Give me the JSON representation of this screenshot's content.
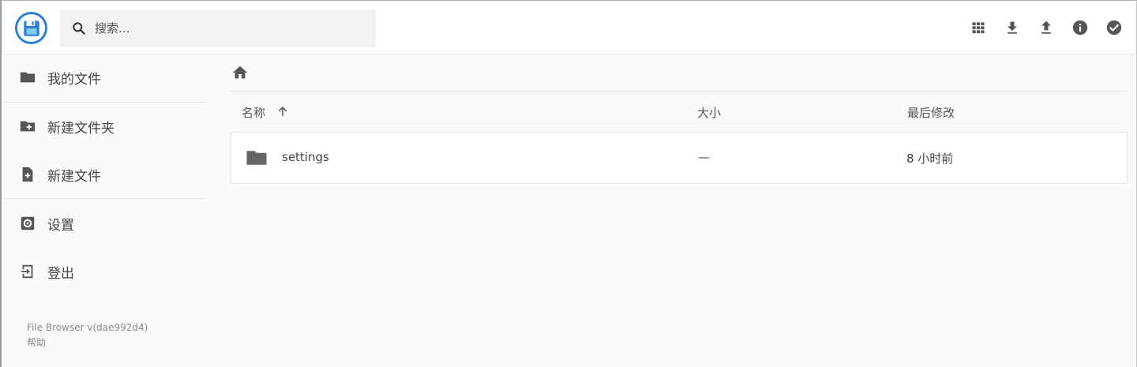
{
  "header": {
    "search": {
      "placeholder": "搜索...",
      "value": ""
    },
    "toolbar": {
      "view_mode_icon": "grid-icon",
      "download_icon": "download-icon",
      "upload_icon": "upload-icon",
      "info_icon": "info-icon",
      "select_icon": "check-circle-icon"
    }
  },
  "sidebar": {
    "items": [
      {
        "label": "我的文件",
        "icon": "folder-icon"
      },
      {
        "label": "新建文件夹",
        "icon": "folder-plus-icon"
      },
      {
        "label": "新建文件",
        "icon": "file-plus-icon"
      },
      {
        "label": "设置",
        "icon": "settings-icon"
      },
      {
        "label": "登出",
        "icon": "logout-icon"
      }
    ],
    "footer": {
      "version": "File Browser v(dae992d4)",
      "help": "帮助"
    }
  },
  "main": {
    "breadcrumb": {
      "home_icon": "home-icon"
    },
    "columns": {
      "name": "名称",
      "size": "大小",
      "modified": "最后修改"
    },
    "files": [
      {
        "name": "settings",
        "size": "—",
        "modified": "8 小时前",
        "icon": "folder-icon"
      }
    ]
  },
  "colors": {
    "accent": "#2f7ed8",
    "icon": "#555555",
    "background": "#fafafa",
    "row_background": "#ffffff"
  }
}
